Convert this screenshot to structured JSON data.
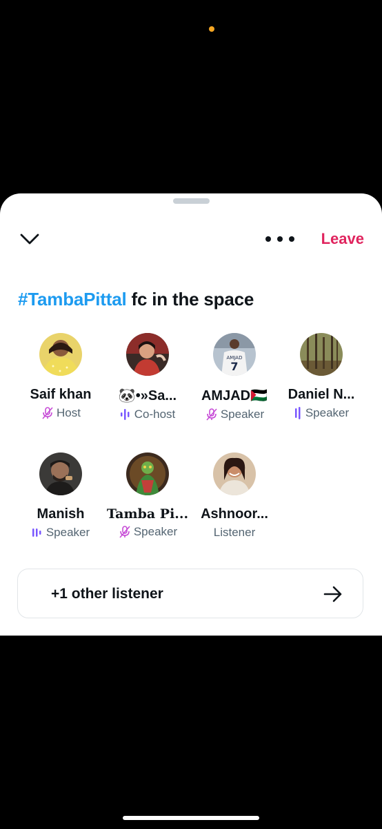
{
  "space": {
    "title_hashtag": "#TambaPittal",
    "title_rest": " fc in the space",
    "leave_label": "Leave",
    "collapse_icon": "chevron-down-icon",
    "more_icon": "more-horizontal-icon"
  },
  "participants": [
    {
      "name": "Saif khan",
      "role": "Host",
      "role_icon": "mic-off-icon"
    },
    {
      "name": "🐼•»Sa...",
      "role": "Co-host",
      "role_icon": "speaking-bars-icon"
    },
    {
      "name": "AMJAD🇵🇸",
      "role": "Speaker",
      "role_icon": "mic-off-icon"
    },
    {
      "name": "Daniel N...",
      "role": "Speaker",
      "role_icon": "speaking-bars-icon"
    },
    {
      "name": "Manish",
      "role": "Speaker",
      "role_icon": "speaking-bars-icon"
    },
    {
      "name": "Tamba Pi...",
      "role": "Speaker",
      "role_icon": "mic-off-icon"
    },
    {
      "name": "Ashnoor...",
      "role": "Listener",
      "role_icon": ""
    }
  ],
  "listeners": {
    "label": "+1 other listener",
    "icon": "arrow-right-icon"
  },
  "colors": {
    "accent": "#1d9bf0",
    "leave": "#e0245e",
    "purple": "#7856ff"
  }
}
